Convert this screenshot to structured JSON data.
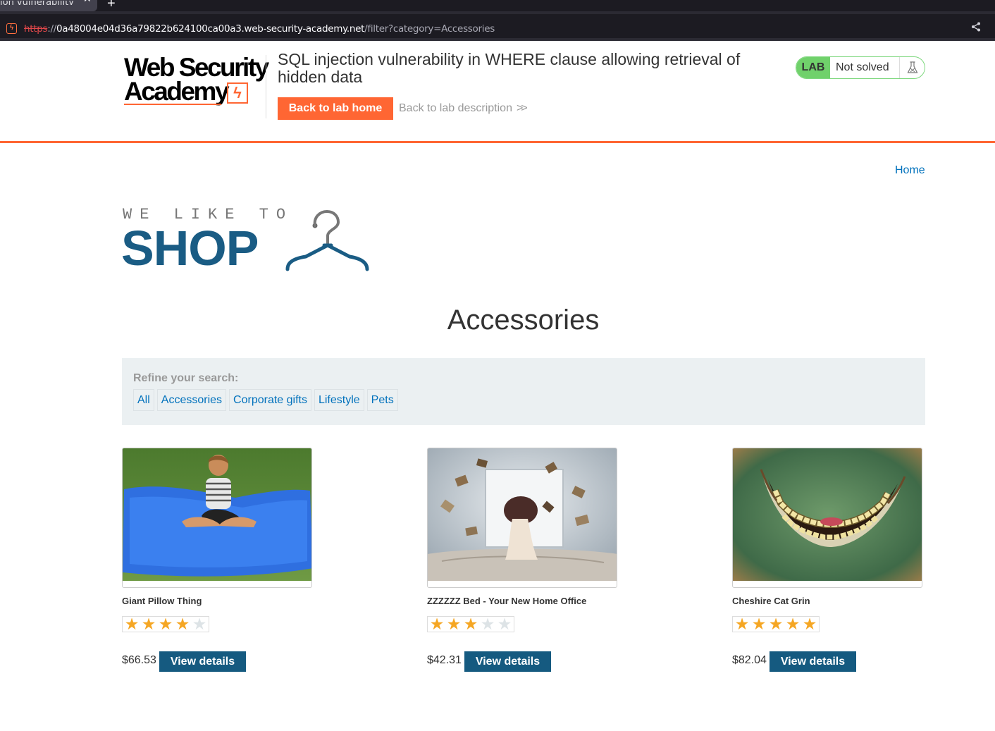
{
  "browser": {
    "tab_title": "ion vulnerability",
    "tab_close": "✕",
    "new_tab": "+",
    "url_protocol": "https",
    "url_separator": "://",
    "url_host": "0a48004e04d36a79822b624100ca00a3.web-security-academy.net",
    "url_path": "/filter?category=Accessories"
  },
  "lab": {
    "logo_line1": "Web Security",
    "logo_line2": "Academy",
    "title": "SQL injection vulnerability in WHERE clause allowing retrieval of hidden data",
    "back_home_label": "Back to lab home",
    "back_desc_label": "Back to lab description",
    "status_tag": "LAB",
    "status_text": "Not solved"
  },
  "nav": {
    "home_label": "Home"
  },
  "shop_logo": {
    "tagline": "WE LIKE TO",
    "word": "SHOP"
  },
  "page": {
    "heading": "Accessories"
  },
  "filters": {
    "label": "Refine your search:",
    "categories": [
      "All",
      "Accessories",
      "Corporate gifts",
      "Lifestyle",
      "Pets"
    ]
  },
  "products": [
    {
      "name": "Giant Pillow Thing",
      "rating": 4,
      "price": "$66.53",
      "button": "View details"
    },
    {
      "name": "ZZZZZZ Bed - Your New Home Office",
      "rating": 3,
      "price": "$42.31",
      "button": "View details"
    },
    {
      "name": "Cheshire Cat Grin",
      "rating": 5,
      "price": "$82.04",
      "button": "View details"
    }
  ],
  "colors": {
    "accent": "#ff6633",
    "link": "#0071bc",
    "shop_blue": "#1a5c84",
    "button_blue": "#155a80",
    "lab_green": "#70d16b",
    "star": "#f5a623"
  }
}
